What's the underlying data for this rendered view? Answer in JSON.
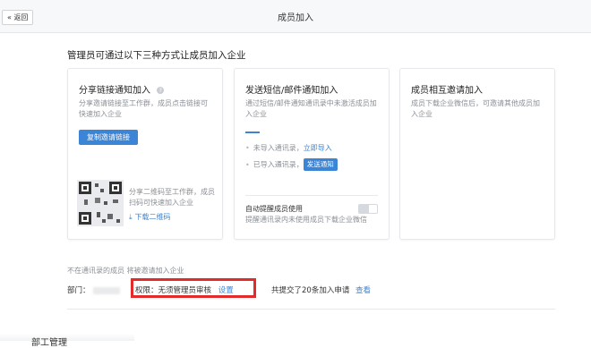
{
  "topbar": {
    "back_label": "« 返回",
    "title": "成员加入"
  },
  "headline": "管理员可通过以下三种方式让成员加入企业",
  "cards": [
    {
      "title": "分享链接通知加入",
      "help_icon": "?",
      "desc": "分享邀请链接至工作群，成员点击链接可快速加入企业",
      "button": "复制邀请链接",
      "qr_desc": "分享二维码至工作群，成员扫码可快速加入企业",
      "download": "下载二维码"
    },
    {
      "title": "发送短信/邮件通知加入",
      "desc": "通过短信/邮件通知通讯录中未激活成员加入企业",
      "unimported_label": "未导入通讯录，",
      "unimported_link": "立即导入",
      "imported_label": "已导入通讯录，",
      "send_button": "发送通知",
      "toggle_label": "自动提醒成员使用",
      "toggle_hint": "提醒通讯录内未使用成员下载企业微信"
    },
    {
      "title": "成员相互邀请加入",
      "desc": "成员下载企业微信后，可邀请其他成员加入企业"
    }
  ],
  "lower": {
    "note": "不在通讯录的成员 将被邀请加入企业",
    "dept_label": "部门：",
    "permission_label": "权限：无须管理员审核",
    "permission_link": "设置",
    "submit_text": "共提交了20条加入申请",
    "submit_link": "查看"
  },
  "bottom": {
    "partial_text": "部工管理"
  },
  "colors": {
    "accent": "#3b84d6",
    "highlight": "#e32b2b"
  }
}
